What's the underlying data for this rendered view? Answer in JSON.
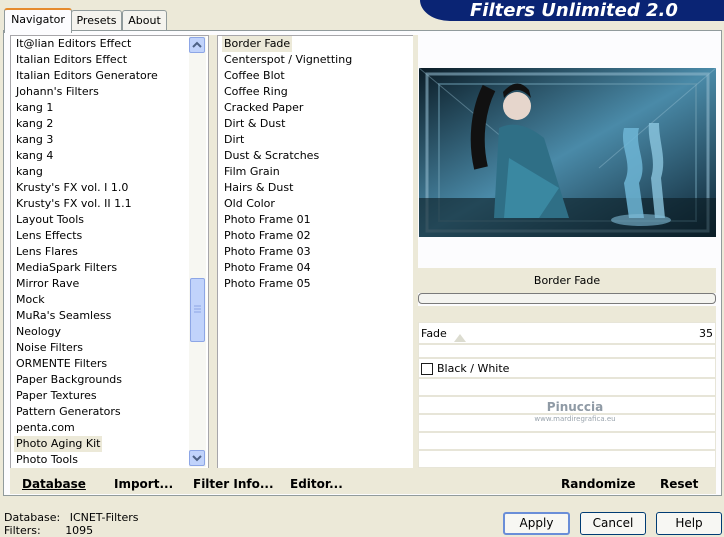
{
  "window": {
    "title": "Filters Unlimited 2.0"
  },
  "tabs": [
    {
      "label": "Navigator",
      "active": true
    },
    {
      "label": "Presets",
      "active": false
    },
    {
      "label": "About",
      "active": false
    }
  ],
  "categories": [
    "It@lian Editors Effect",
    "Italian Editors Effect",
    "Italian Editors Generatore",
    "Johann's Filters",
    "kang 1",
    "kang 2",
    "kang 3",
    "kang 4",
    "kang",
    "Krusty's FX vol. I 1.0",
    "Krusty's FX vol. II 1.1",
    "Layout Tools",
    "Lens Effects",
    "Lens Flares",
    "MediaSpark Filters",
    "Mirror Rave",
    "Mock",
    "MuRa's Seamless",
    "Neology",
    "Noise Filters",
    "ORMENTE Filters",
    "Paper Backgrounds",
    "Paper Textures",
    "Pattern Generators",
    "penta.com",
    "Photo Aging Kit",
    "Photo Tools"
  ],
  "selected_category": "Photo Aging Kit",
  "filters": [
    "Border Fade",
    "Centerspot / Vignetting",
    "Coffee Blot",
    "Coffee Ring",
    "Cracked Paper",
    "Dirt & Dust",
    "Dirt",
    "Dust & Scratches",
    "Film Grain",
    "Hairs & Dust",
    "Old Color",
    "Photo Frame 01",
    "Photo Frame 02",
    "Photo Frame 03",
    "Photo Frame 04",
    "Photo Frame 05"
  ],
  "selected_filter": "Border Fade",
  "settings": {
    "filter_name": "Border Fade",
    "fade_label": "Fade",
    "fade_value": "35",
    "fade_fraction": 0.14,
    "checkbox_label": "Black / White",
    "checkbox_checked": false
  },
  "watermark": {
    "name": "Pinuccia",
    "site": "www.mardiregrafica.eu"
  },
  "bottom_toolbar": {
    "database": "Database",
    "import": "Import...",
    "filter_info": "Filter Info...",
    "editor": "Editor...",
    "randomize": "Randomize",
    "reset": "Reset"
  },
  "status": {
    "database_label": "Database:",
    "database_value": "ICNET-Filters",
    "filters_label": "Filters:",
    "filters_value": "1095"
  },
  "buttons": {
    "apply": "Apply",
    "cancel": "Cancel",
    "help": "Help"
  },
  "colors": {
    "banner": "#0a2474",
    "tab_accent": "#e68b2c",
    "scroll": "#c1d3fb"
  }
}
